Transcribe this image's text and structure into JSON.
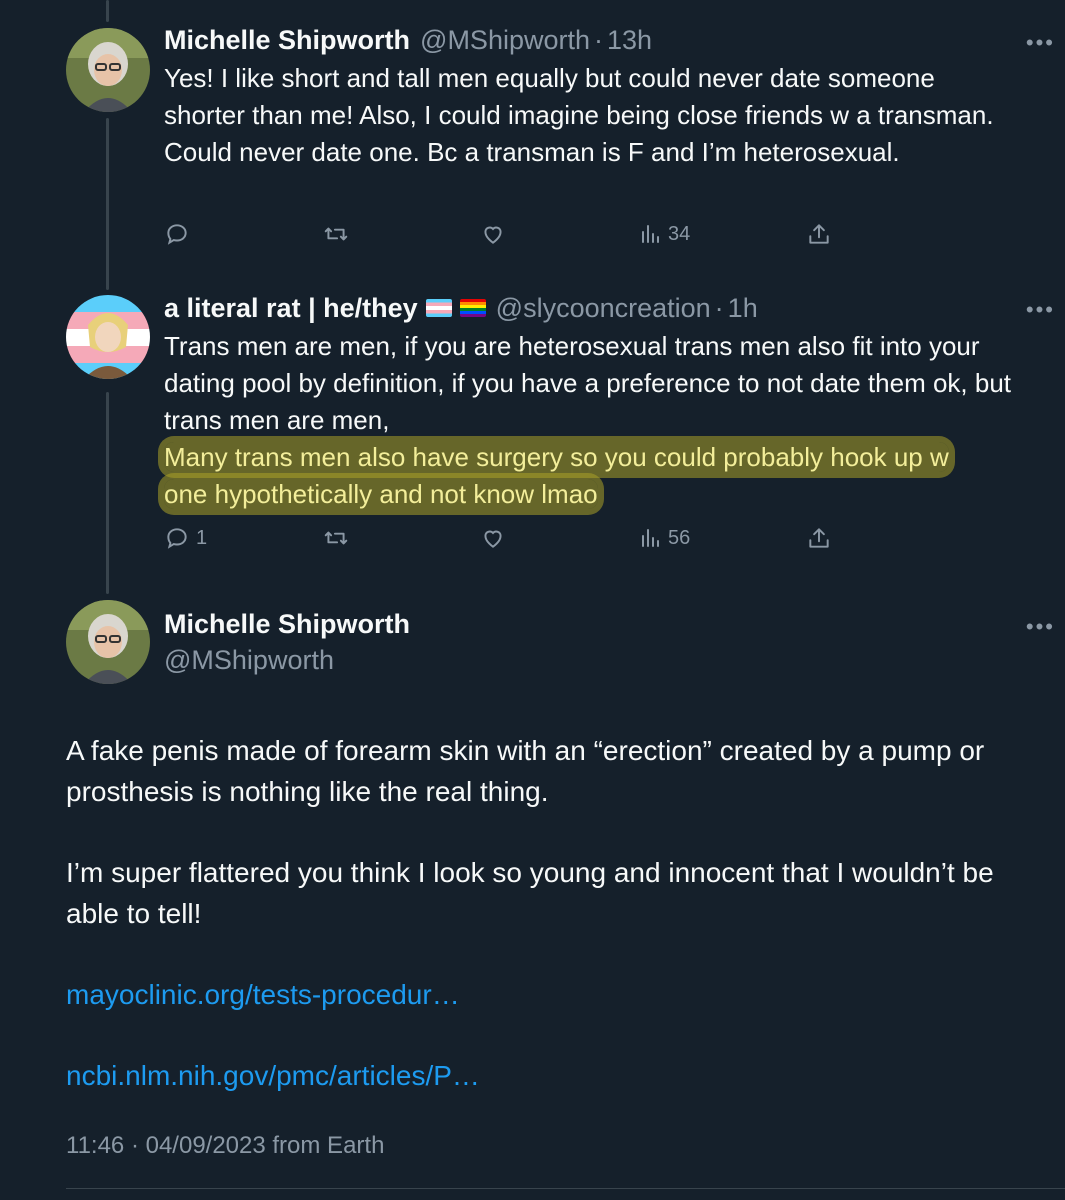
{
  "tweets": [
    {
      "name": "Michelle Shipworth",
      "handle": "@MShipworth",
      "dot": "·",
      "time": "13h",
      "text": "Yes! I like short and tall men equally but could never date someone shorter than me! Also, I could imagine being close friends w a transman. Could never date one. Bc a transman is F and I’m heterosexual.",
      "views": "34",
      "replies": ""
    },
    {
      "name": "a literal rat | he/they",
      "handle": "@slycooncreation",
      "dot": "·",
      "time": "1h",
      "text_plain": "Trans men are men, if you are heterosexual trans men also fit into your dating pool by definition, if you have a preference to not date them ok, but trans men are men,",
      "text_highlight_1": "Many trans men also have surgery so you could probably hook up w",
      "text_highlight_2": "one hypothetically and not know lmao",
      "replies": "1",
      "views": "56"
    }
  ],
  "main": {
    "name": "Michelle Shipworth",
    "handle": "@MShipworth",
    "para1": "A fake penis made of forearm skin with an “erection” created by a pump or prosthesis is nothing like the real thing.",
    "para2": "I’m super flattered you think I look so young and innocent that I wouldn’t be able to tell!",
    "link1": "mayoclinic.org/tests-procedur…",
    "link2": "ncbi.nlm.nih.gov/pmc/articles/P…",
    "footer": "11:46 · 04/09/2023 from Earth"
  },
  "more_glyph": "•••",
  "icons": [
    "reply-icon",
    "retweet-icon",
    "like-icon",
    "views-icon",
    "share-icon",
    "more-icon"
  ],
  "colors": {
    "background": "#15202b",
    "link": "#1d9bf0",
    "muted": "#8b98a5",
    "highlight": "#aaa028"
  }
}
